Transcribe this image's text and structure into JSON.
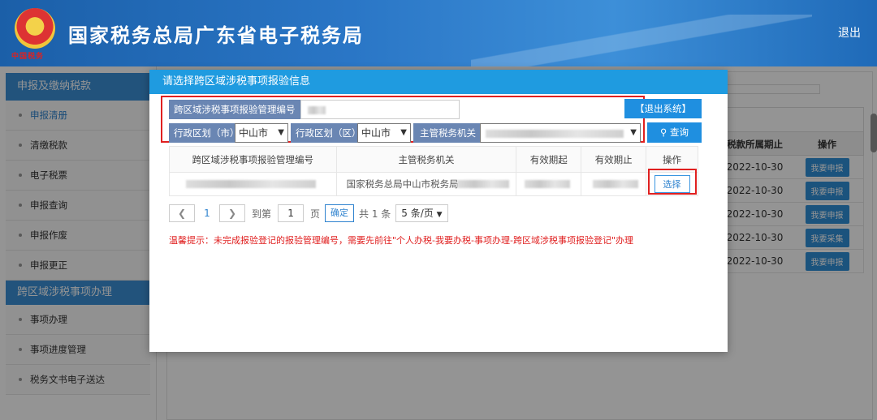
{
  "header": {
    "title": "国家税务总局广东省电子税务局",
    "emblem_text": "中国税务",
    "logout": "退出"
  },
  "sidebar": {
    "section1": "申报及缴纳税款",
    "items1": [
      "申报清册",
      "清缴税款",
      "电子税票",
      "申报查询",
      "申报作废",
      "申报更正"
    ],
    "section2": "跨区域涉税事项办理",
    "items2": [
      "事项办理",
      "事项进度管理",
      "税务文书电子送达"
    ]
  },
  "background_table": {
    "headers": [
      "税款所属期止",
      "操作"
    ],
    "rows": [
      {
        "date": "2022-10-30",
        "action": "我要申报"
      },
      {
        "date": "2022-10-30",
        "action": "我要申报"
      },
      {
        "date": "2022-10-30",
        "action": "我要申报"
      },
      {
        "date": "2022-10-30",
        "action": "我要采集"
      },
      {
        "date": "2022-10-30",
        "action": "我要申报"
      }
    ]
  },
  "dialog": {
    "title": "请选择跨区域涉税事项报验信息",
    "filters": {
      "code_label": "跨区域涉税事项报验管理编号",
      "city_label": "行政区划（市）",
      "city_value": "中山市",
      "district_label": "行政区划（区）",
      "district_value": "中山市",
      "office_label": "主管税务机关"
    },
    "exit_button": "【退出系统】",
    "query_button": "查询",
    "table": {
      "headers": [
        "跨区域涉税事项报验管理编号",
        "主管税务机关",
        "有效期起",
        "有效期止",
        "操作"
      ],
      "rows": [
        {
          "office": "国家税务总局中山市税务局",
          "action": "选择"
        }
      ]
    },
    "pager": {
      "current": "1",
      "goto_prefix": "到第",
      "goto_value": "1",
      "goto_suffix": "页",
      "confirm": "确定",
      "total": "共 1 条",
      "page_size": "5 条/页"
    },
    "tip": "温馨提示：未完成报验登记的报验管理编号，需要先前往\"个人办税-我要办税-事项办理-跨区域涉税事项报验登记\"办理"
  }
}
